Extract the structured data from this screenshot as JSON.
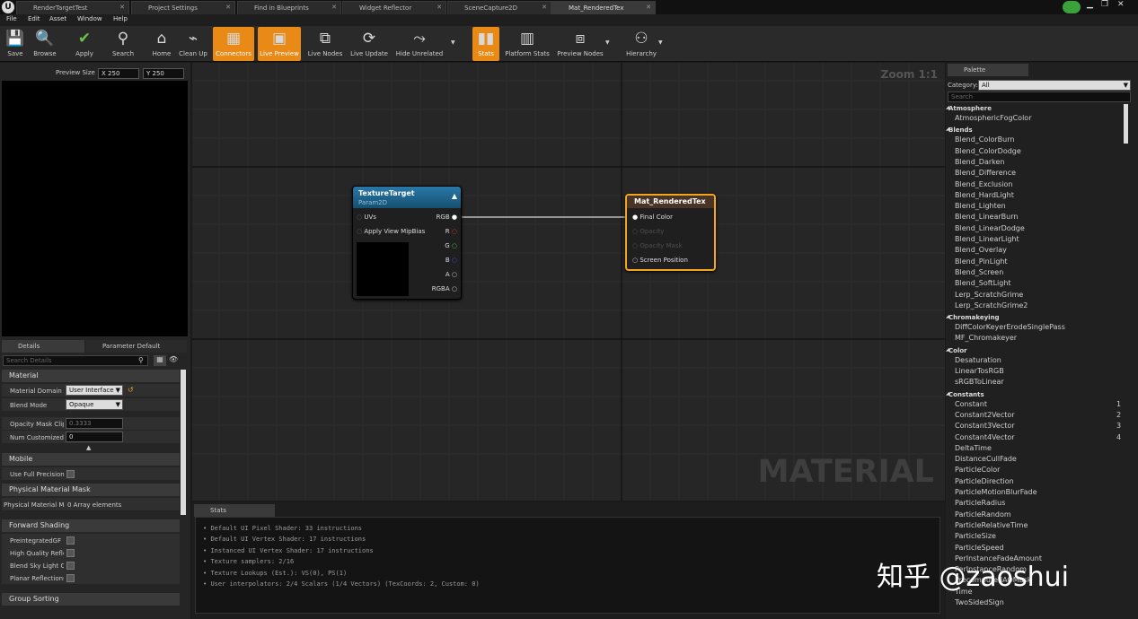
{
  "tabs": [
    {
      "label": "RenderTargetTest"
    },
    {
      "label": "Project Settings"
    },
    {
      "label": "Find in Blueprints"
    },
    {
      "label": "Widget Reflector"
    },
    {
      "label": "SceneCapture2D"
    },
    {
      "label": "Mat_RenderedTex"
    }
  ],
  "menu": [
    "File",
    "Edit",
    "Asset",
    "Window",
    "Help"
  ],
  "toolbar": {
    "save": "Save",
    "browse": "Browse",
    "apply": "Apply",
    "search": "Search",
    "home": "Home",
    "cleanup": "Clean Up",
    "connectors": "Connectors",
    "live_preview": "Live Preview",
    "live_nodes": "Live Nodes",
    "live_update": "Live Update",
    "hide_unrelated": "Hide Unrelated",
    "stats": "Stats",
    "platform_stats": "Platform Stats",
    "preview_nodes": "Preview Nodes",
    "hierarchy": "Hierarchy"
  },
  "preview": {
    "size_label": "Preview Size",
    "x_label": "X",
    "x_value": "250",
    "y_label": "Y",
    "y_value": "250"
  },
  "details": {
    "tab_details": "Details",
    "tab_params": "Parameter Default",
    "search_placeholder": "Search Details",
    "section_material": "Material",
    "material_domain_label": "Material Domain",
    "material_domain_value": "User Interface",
    "blend_mode_label": "Blend Mode",
    "blend_mode_value": "Opaque",
    "opacity_mask_label": "Opacity Mask Clip Va",
    "opacity_mask_value": "0.3333",
    "num_custom_uv_label": "Num Customized UV",
    "num_custom_uv_value": "0",
    "section_mobile": "Mobile",
    "use_full_precision": "Use Full Precision",
    "section_pmm": "Physical Material Mask",
    "pmm_label": "Physical Material Ma",
    "pmm_value": "0 Array elements",
    "section_forward": "Forward Shading",
    "fs_preintegrated": "PreintegratedGF For",
    "fs_hq_reflect": "High Quality Reflectio",
    "fs_blend_sky": "Blend Sky Light Cube",
    "fs_planar": "Planar Reflections",
    "section_group": "Group Sorting"
  },
  "graph": {
    "zoom": "Zoom 1:1",
    "watermark": "MATERIAL",
    "texture_node": {
      "title": "TextureTarget",
      "subtitle": "Param2D",
      "in_uvs": "UVs",
      "in_mip": "Apply View MipBias",
      "out_rgb": "RGB",
      "out_r": "R",
      "out_g": "G",
      "out_b": "B",
      "out_a": "A",
      "out_rgba": "RGBA"
    },
    "material_node": {
      "title": "Mat_RenderedTex",
      "final_color": "Final Color",
      "opacity": "Opacity",
      "opacity_mask": "Opacity Mask",
      "screen_pos": "Screen Position"
    }
  },
  "stats": {
    "tab": "Stats",
    "lines": [
      "Default UI Pixel Shader: 33 instructions",
      "Default UI Vertex Shader: 17 instructions",
      "Instanced UI Vertex Shader: 17 instructions",
      "Texture samplers: 2/16",
      "Texture Lookups (Est.): VS(0), PS(1)",
      "User interpolators: 2/4 Scalars (1/4 Vectors) (TexCoords: 2, Custom: 0)"
    ]
  },
  "palette": {
    "tab": "Palette",
    "category_label": "Category:",
    "category_value": "All",
    "search_placeholder": "Search",
    "rows": [
      {
        "t": "c",
        "label": "Atmosphere"
      },
      {
        "t": "i",
        "label": "AtmosphericFogColor"
      },
      {
        "t": "c",
        "label": "Blends"
      },
      {
        "t": "i",
        "label": "Blend_ColorBurn"
      },
      {
        "t": "i",
        "label": "Blend_ColorDodge"
      },
      {
        "t": "i",
        "label": "Blend_Darken"
      },
      {
        "t": "i",
        "label": "Blend_Difference"
      },
      {
        "t": "i",
        "label": "Blend_Exclusion"
      },
      {
        "t": "i",
        "label": "Blend_HardLight"
      },
      {
        "t": "i",
        "label": "Blend_Lighten"
      },
      {
        "t": "i",
        "label": "Blend_LinearBurn"
      },
      {
        "t": "i",
        "label": "Blend_LinearDodge"
      },
      {
        "t": "i",
        "label": "Blend_LinearLight"
      },
      {
        "t": "i",
        "label": "Blend_Overlay"
      },
      {
        "t": "i",
        "label": "Blend_PinLight"
      },
      {
        "t": "i",
        "label": "Blend_Screen"
      },
      {
        "t": "i",
        "label": "Blend_SoftLight"
      },
      {
        "t": "i",
        "label": "Lerp_ScratchGrime"
      },
      {
        "t": "i",
        "label": "Lerp_ScratchGrime2"
      },
      {
        "t": "c",
        "label": "Chromakeying"
      },
      {
        "t": "i",
        "label": "DiffColorKeyerErodeSinglePass"
      },
      {
        "t": "i",
        "label": "MF_Chromakeyer"
      },
      {
        "t": "c",
        "label": "Color"
      },
      {
        "t": "i",
        "label": "Desaturation"
      },
      {
        "t": "i",
        "label": "LinearTosRGB"
      },
      {
        "t": "i",
        "label": "sRGBToLinear"
      },
      {
        "t": "c",
        "label": "Constants"
      },
      {
        "t": "i",
        "label": "Constant",
        "num": "1"
      },
      {
        "t": "i",
        "label": "Constant2Vector",
        "num": "2"
      },
      {
        "t": "i",
        "label": "Constant3Vector",
        "num": "3"
      },
      {
        "t": "i",
        "label": "Constant4Vector",
        "num": "4"
      },
      {
        "t": "i",
        "label": "DeltaTime"
      },
      {
        "t": "i",
        "label": "DistanceCullFade"
      },
      {
        "t": "i",
        "label": "ParticleColor"
      },
      {
        "t": "i",
        "label": "ParticleDirection"
      },
      {
        "t": "i",
        "label": "ParticleMotionBlurFade"
      },
      {
        "t": "i",
        "label": "ParticleRadius"
      },
      {
        "t": "i",
        "label": "ParticleRandom"
      },
      {
        "t": "i",
        "label": "ParticleRelativeTime"
      },
      {
        "t": "i",
        "label": "ParticleSize"
      },
      {
        "t": "i",
        "label": "ParticleSpeed"
      },
      {
        "t": "i",
        "label": "PerInstanceFadeAmount"
      },
      {
        "t": "i",
        "label": "PerInstanceRandom"
      },
      {
        "t": "i",
        "label": "PrecomputedAOMask"
      },
      {
        "t": "i",
        "label": "Time"
      },
      {
        "t": "i",
        "label": "TwoSidedSign"
      }
    ]
  },
  "watermark": "知乎 @zaoshui",
  "colors": {
    "accent": "#e98a17",
    "node_header_blue": "#1d5f86",
    "node_header_brown": "#4a3426",
    "selected_border": "#f2a51d"
  }
}
